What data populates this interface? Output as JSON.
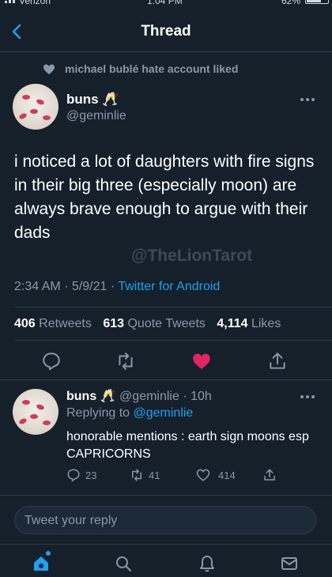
{
  "status_bar": {
    "carrier": "Verizon",
    "time": "1:04 PM",
    "battery": "62%"
  },
  "header": {
    "title": "Thread"
  },
  "social_context": {
    "text": "michael bublé hate account liked"
  },
  "main_tweet": {
    "name": "buns",
    "name_emoji": "🥂",
    "handle": "@geminlie",
    "text": "i noticed a lot of daughters with fire signs in their big three (especially moon) are always brave enough to argue with their dads",
    "watermark": "@TheLionTarot",
    "time": "2:34 AM",
    "date": "5/9/21",
    "source": "Twitter for Android",
    "stats": {
      "retweets": "406",
      "retweets_label": "Retweets",
      "quotes": "613",
      "quotes_label": "Quote Tweets",
      "likes": "4,114",
      "likes_label": "Likes"
    }
  },
  "reply_tweet": {
    "name": "buns",
    "name_emoji": "🥂",
    "handle": "@geminlie",
    "age": "10h",
    "replying_label": "Replying to",
    "replying_to": "@geminlie",
    "text": "honorable mentions : earth sign moons esp CAPRICORNS",
    "replies": "23",
    "retweets": "41",
    "likes": "414"
  },
  "compose": {
    "placeholder": "Tweet your reply"
  },
  "colors": {
    "background": "#15202b",
    "accent": "#1da1f2",
    "like": "#e0245e",
    "muted": "#8899a6"
  },
  "icons": [
    "back-icon",
    "heart-icon",
    "more-icon",
    "reply-icon",
    "retweet-icon",
    "like-icon",
    "share-icon",
    "home-icon",
    "search-icon",
    "notifications-icon",
    "messages-icon"
  ]
}
